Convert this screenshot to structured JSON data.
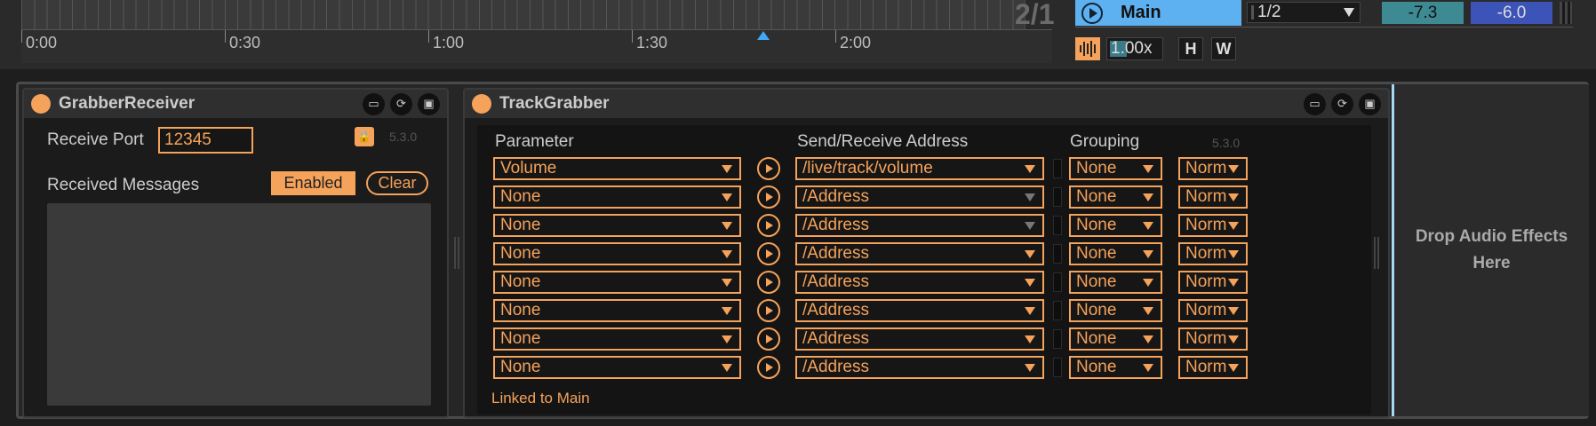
{
  "timeline": {
    "ticks": [
      "0:00",
      "0:30",
      "1:00",
      "1:30",
      "2:00"
    ],
    "signature": "2/1",
    "main_label": "Main",
    "quantization": "1/2",
    "volume_left": "-7.3",
    "volume_right": "-6.0",
    "zoom": "1.00x",
    "h_label": "H",
    "w_label": "W"
  },
  "receiver": {
    "title": "GrabberReceiver",
    "port_label": "Receive Port",
    "port_value": "12345",
    "version": "5.3.0",
    "messages_label": "Received Messages",
    "enabled_label": "Enabled",
    "clear_label": "Clear"
  },
  "grabber": {
    "title": "TrackGrabber",
    "col_parameter": "Parameter",
    "col_address": "Send/Receive Address",
    "col_grouping": "Grouping",
    "version": "5.3.0",
    "footer": "Linked to Main",
    "rows": [
      {
        "param": "Volume",
        "address": "/live/track/volume",
        "group": "None",
        "mode": "Norm"
      },
      {
        "param": "None",
        "address": "/Address",
        "group": "None",
        "mode": "Norm"
      },
      {
        "param": "None",
        "address": "/Address",
        "group": "None",
        "mode": "Norm"
      },
      {
        "param": "None",
        "address": "/Address",
        "group": "None",
        "mode": "Norm"
      },
      {
        "param": "None",
        "address": "/Address",
        "group": "None",
        "mode": "Norm"
      },
      {
        "param": "None",
        "address": "/Address",
        "group": "None",
        "mode": "Norm"
      },
      {
        "param": "None",
        "address": "/Address",
        "group": "None",
        "mode": "Norm"
      },
      {
        "param": "None",
        "address": "/Address",
        "group": "None",
        "mode": "Norm"
      }
    ]
  },
  "dropzone": {
    "line1": "Drop Audio Effects",
    "line2": "Here"
  },
  "colors": {
    "accent": "#f5a25a",
    "main_button": "#5eb1f0",
    "vol_left": "#3d8a93",
    "vol_right": "#3c53b8"
  }
}
